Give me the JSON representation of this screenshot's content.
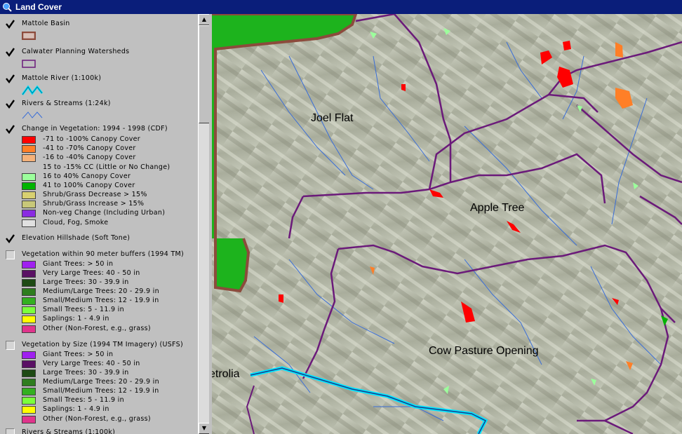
{
  "window": {
    "title": "Land Cover"
  },
  "legend": {
    "layers": [
      {
        "name": "Mattole Basin",
        "checked": true,
        "symbol": "box-outline",
        "color": "#8c4b3c"
      },
      {
        "name": "Calwater Planning Watersheds",
        "checked": true,
        "symbol": "box-outline",
        "color": "#6b1a7a"
      },
      {
        "name": "Mattole River (1:100k)",
        "checked": true,
        "symbol": "line-thick",
        "color": "#00e5ff"
      },
      {
        "name": "Rivers & Streams (1:24k)",
        "checked": true,
        "symbol": "line-thin",
        "color": "#3a6ed8"
      },
      {
        "name": "Change in Vegetation: 1994 - 1998 (CDF)",
        "checked": true,
        "classes": [
          {
            "label": "-71 to -100% Canopy Cover",
            "color": "#ff0000"
          },
          {
            "label": "-41 to -70% Canopy Cover",
            "color": "#ff7f27"
          },
          {
            "label": "-16 to -40% Canopy Cover",
            "color": "#f5b27a"
          },
          {
            "label": "15 to -15% CC (Little or No Change)",
            "color": ""
          },
          {
            "label": "16 to 40% Canopy Cover",
            "color": "#9cff9c"
          },
          {
            "label": "41 to 100% Canopy Cover",
            "color": "#00b400"
          },
          {
            "label": "Shrub/Grass Decrease > 15%",
            "color": "#d8d070"
          },
          {
            "label": "Shrub/Grass Increase > 15%",
            "color": "#c8c878"
          },
          {
            "label": "Non-veg Change (Including Urban)",
            "color": "#8a2be2"
          },
          {
            "label": "Cloud, Fog, Smoke",
            "color": "#e0e0e0"
          }
        ]
      },
      {
        "name": "Elevation Hillshade (Soft Tone)",
        "checked": true
      },
      {
        "name": "Vegetation within 90 meter buffers (1994 TM)",
        "checked": false,
        "classes": [
          {
            "label": "Giant Trees: > 50 in",
            "color": "#a020f0"
          },
          {
            "label": "Very Large Trees: 40 - 50 in",
            "color": "#5a1064"
          },
          {
            "label": "Large Trees: 30 - 39.9 in",
            "color": "#1e4a14"
          },
          {
            "label": "Medium/Large Trees: 20 - 29.9 in",
            "color": "#2e7d1e"
          },
          {
            "label": "Small/Medium Trees: 12 - 19.9 in",
            "color": "#33b020"
          },
          {
            "label": "Small Trees: 5 - 11.9 in",
            "color": "#7cff3c"
          },
          {
            "label": "Saplings: 1 - 4.9 in",
            "color": "#ffff00"
          },
          {
            "label": "Other (Non-Forest, e.g., grass)",
            "color": "#e0348c"
          }
        ]
      },
      {
        "name": "Vegetation by Size (1994 TM Imagery) (USFS)",
        "checked": false,
        "classes": [
          {
            "label": "Giant Trees: > 50 in",
            "color": "#a020f0"
          },
          {
            "label": "Very Large Trees: 40 - 50 in",
            "color": "#5a1064"
          },
          {
            "label": "Large Trees: 30 - 39.9 in",
            "color": "#1e4a14"
          },
          {
            "label": "Medium/Large Trees: 20 - 29.9 in",
            "color": "#2e7d1e"
          },
          {
            "label": "Small/Medium Trees: 12 - 19.9 in",
            "color": "#33b020"
          },
          {
            "label": "Small Trees: 5 - 11.9 in",
            "color": "#7cff3c"
          },
          {
            "label": "Saplings: 1 - 4.9 in",
            "color": "#ffff00"
          },
          {
            "label": "Other (Non-Forest, e.g., grass)",
            "color": "#e0348c"
          }
        ]
      },
      {
        "name": "Rivers & Streams (1:100k)",
        "checked": false
      }
    ]
  },
  "map": {
    "labels": [
      "Joel Flat",
      "Apple Tree",
      "Cow Pasture Opening",
      "etrolia"
    ],
    "colors": {
      "ocean": "#1db31d",
      "terrain": "#b9bcad",
      "basin": "#8c4b3c",
      "watershed": "#6b1a7a",
      "river": "#00e5ff",
      "streams": "#3a6ed8"
    }
  }
}
